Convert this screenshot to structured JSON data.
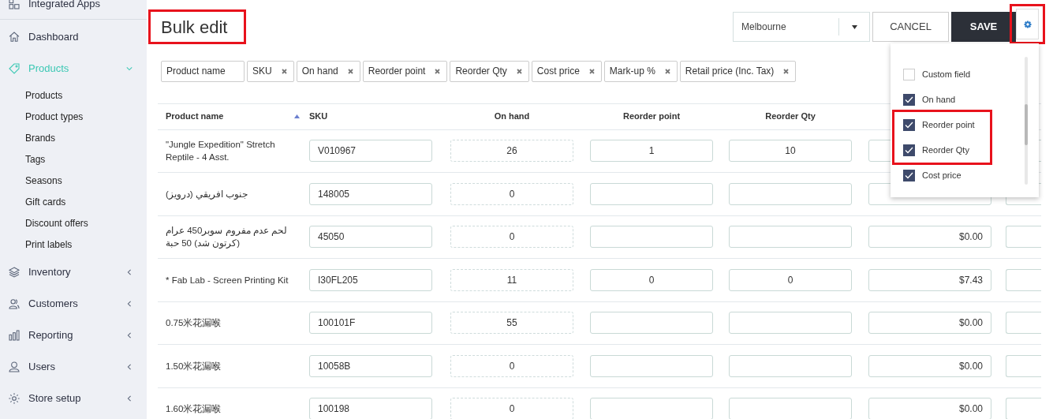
{
  "sidebar": {
    "items": [
      {
        "label": "Integrated Apps",
        "selected": false
      },
      {
        "label": "Dashboard",
        "selected": false
      },
      {
        "label": "Products",
        "selected": true,
        "expanded": true,
        "children": [
          {
            "label": "Products"
          },
          {
            "label": "Product types"
          },
          {
            "label": "Brands"
          },
          {
            "label": "Tags"
          },
          {
            "label": "Seasons"
          },
          {
            "label": "Gift cards"
          },
          {
            "label": "Discount offers"
          },
          {
            "label": "Print labels"
          }
        ]
      },
      {
        "label": "Inventory",
        "selected": false,
        "expanded": false
      },
      {
        "label": "Customers",
        "selected": false,
        "expanded": false
      },
      {
        "label": "Reporting",
        "selected": false,
        "expanded": false
      },
      {
        "label": "Users",
        "selected": false,
        "expanded": false
      },
      {
        "label": "Store setup",
        "selected": false,
        "expanded": false
      }
    ]
  },
  "title": {
    "text": "Bulk edit",
    "highlighted": true
  },
  "outlet_select": {
    "value": "Melbourne"
  },
  "buttons": {
    "cancel": "CANCEL",
    "save": "SAVE"
  },
  "settings_button": {
    "highlighted": true
  },
  "column_chips": [
    {
      "label": "Product name",
      "removable": false
    },
    {
      "label": "SKU",
      "removable": true
    },
    {
      "label": "On hand",
      "removable": true
    },
    {
      "label": "Reorder point",
      "removable": true
    },
    {
      "label": "Reorder Qty",
      "removable": true
    },
    {
      "label": "Cost price",
      "removable": true
    },
    {
      "label": "Mark-up %",
      "removable": true
    },
    {
      "label": "Retail price (Inc. Tax)",
      "removable": true
    }
  ],
  "table": {
    "columns": [
      "Product name",
      "SKU",
      "On hand",
      "Reorder point",
      "Reorder Qty"
    ],
    "sort_ascending": true,
    "rows": [
      {
        "name": "\"Jungle Expedition\" Stretch Reptile - 4 Asst.",
        "sku": "V010967",
        "on_hand": "26",
        "reorder_point": "1",
        "reorder_qty": "10"
      },
      {
        "name": "جنوب افريقي (درويز)",
        "sku": "148005",
        "on_hand": "0"
      },
      {
        "name": "لحم عدم مفروم سوبر450 عرام (كرتون شد) 50 حبة",
        "sku": "45050",
        "on_hand": "0",
        "cost_price": "$0.00"
      },
      {
        "name": "* Fab Lab - Screen Printing Kit",
        "sku": "I30FL205",
        "on_hand": "11",
        "reorder_point": "0",
        "reorder_qty": "0",
        "cost_price": "$7.43"
      },
      {
        "name": "0.75米花漏喉",
        "sku": "100101F",
        "on_hand": "55",
        "cost_price": "$0.00"
      },
      {
        "name": "1.50米花漏喉",
        "sku": "10058B",
        "on_hand": "0",
        "cost_price": "$0.00"
      },
      {
        "name": "1.60米花漏喉",
        "sku": "100198",
        "on_hand": "0",
        "cost_price": "$0.00"
      }
    ]
  },
  "column_menu": {
    "options": [
      {
        "label": "Custom field",
        "checked": false,
        "highlighted": false
      },
      {
        "label": "On hand",
        "checked": true,
        "highlighted": false
      },
      {
        "label": "Reorder point",
        "checked": true,
        "highlighted": true
      },
      {
        "label": "Reorder Qty",
        "checked": true,
        "highlighted": true
      },
      {
        "label": "Cost price",
        "checked": true,
        "highlighted": false
      }
    ]
  }
}
